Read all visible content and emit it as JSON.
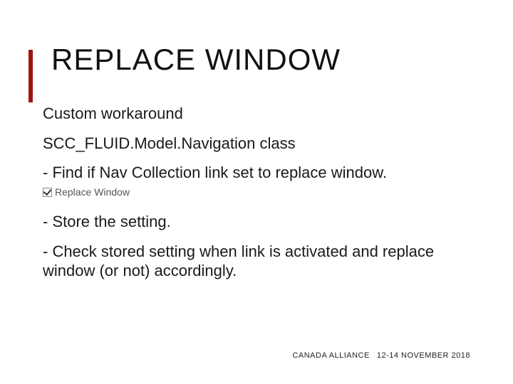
{
  "title": "REPLACE WINDOW",
  "body": {
    "p1": "Custom workaround",
    "p2": "SCC_FLUID.Model.Navigation class",
    "p3a": "- Find if Nav Collection link set to replace window.",
    "checkbox_label": "Replace Window",
    "p4": "- Store the setting.",
    "p5": "- Check stored setting when link is activated and replace window (or not) accordingly."
  },
  "footer": {
    "org": "CANADA ALLIANCE",
    "date": "12-14 NOVEMBER 2018"
  }
}
